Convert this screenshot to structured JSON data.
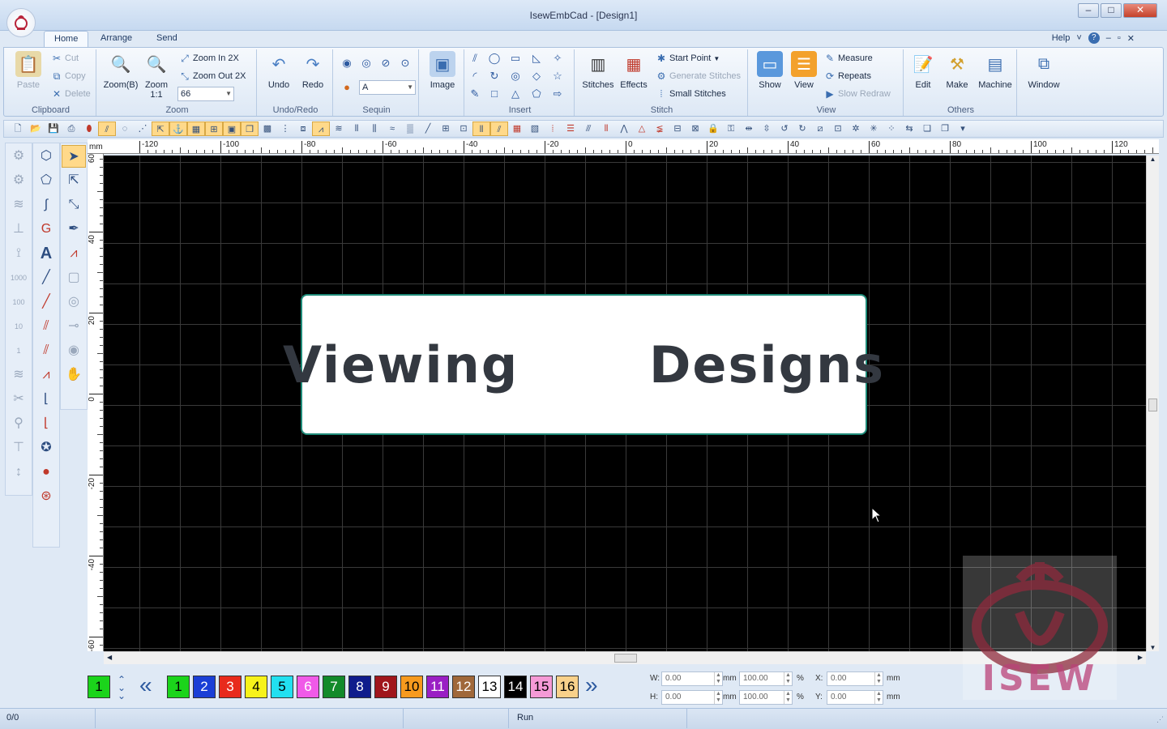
{
  "window": {
    "title": "IsewEmbCad - [Design1]",
    "min": "–",
    "max": "□",
    "close": "✕"
  },
  "tabs": [
    "Home",
    "Arrange",
    "Send"
  ],
  "help": {
    "label": "Help",
    "dropdown": "˅",
    "help_icon": "?",
    "min": "–",
    "restore": "▫",
    "close": "✕"
  },
  "ribbon": {
    "clipboard": {
      "label": "Clipboard",
      "paste": "Paste",
      "cut": "Cut",
      "copy": "Copy",
      "delete": "Delete"
    },
    "zoom": {
      "label": "Zoom",
      "zoom_b": "Zoom(B)",
      "zoom_11_line1": "Zoom",
      "zoom_11_line2": "1:1",
      "zoom_in": "Zoom In 2X",
      "zoom_out": "Zoom Out 2X",
      "zoom_value": "66"
    },
    "undo_redo": {
      "label": "Undo/Redo",
      "undo": "Undo",
      "redo": "Redo"
    },
    "sequin": {
      "label": "Sequin",
      "value": "A"
    },
    "image": {
      "label": "Image"
    },
    "insert": {
      "label": "Insert"
    },
    "stitch": {
      "label": "Stitch",
      "stitches": "Stitches",
      "effects": "Effects",
      "start_point": "Start Point",
      "generate": "Generate Stitches",
      "small": "Small Stitches"
    },
    "view": {
      "label": "View",
      "show": "Show",
      "view": "View",
      "measure": "Measure",
      "repeats": "Repeats",
      "slow_redraw": "Slow Redraw"
    },
    "others": {
      "label": "Others",
      "edit": "Edit",
      "make": "Make",
      "machine": "Machine"
    },
    "window": {
      "label": "Window"
    }
  },
  "ruler": {
    "unit": "mm",
    "top_ticks": [
      "-120",
      "-100",
      "-80",
      "-60",
      "-40",
      "-20",
      "0",
      "20",
      "40",
      "60",
      "80",
      "100",
      "120"
    ],
    "left_ticks": [
      "60",
      "40",
      "20",
      "0",
      "-20",
      "-40",
      "-60"
    ]
  },
  "overlay": {
    "text": "Viewing   Designs"
  },
  "colors": {
    "current": "1",
    "swatches": [
      {
        "n": "1",
        "bg": "#1bd41b",
        "fg": "#000000"
      },
      {
        "n": "2",
        "bg": "#1a3fd6",
        "fg": "#ffffff"
      },
      {
        "n": "3",
        "bg": "#e82a1c",
        "fg": "#ffffff"
      },
      {
        "n": "4",
        "bg": "#f7f21a",
        "fg": "#000000"
      },
      {
        "n": "5",
        "bg": "#22e0f0",
        "fg": "#000000"
      },
      {
        "n": "6",
        "bg": "#f05ae8",
        "fg": "#ffffff"
      },
      {
        "n": "7",
        "bg": "#128a2a",
        "fg": "#ffffff"
      },
      {
        "n": "8",
        "bg": "#0f1c8c",
        "fg": "#ffffff"
      },
      {
        "n": "9",
        "bg": "#a0161c",
        "fg": "#ffffff"
      },
      {
        "n": "10",
        "bg": "#f79a1e",
        "fg": "#000000"
      },
      {
        "n": "11",
        "bg": "#9a1fc4",
        "fg": "#ffffff"
      },
      {
        "n": "12",
        "bg": "#a0683a",
        "fg": "#ffffff"
      },
      {
        "n": "13",
        "bg": "#ffffff",
        "fg": "#000000"
      },
      {
        "n": "14",
        "bg": "#000000",
        "fg": "#ffffff"
      },
      {
        "n": "15",
        "bg": "#f59ad6",
        "fg": "#000000"
      },
      {
        "n": "16",
        "bg": "#f9d18a",
        "fg": "#000000"
      }
    ],
    "prev": "«",
    "next": "»"
  },
  "coords": {
    "w_label": "W:",
    "w_value": "0.00",
    "w_unit": "mm",
    "h_label": "H:",
    "h_value": "0.00",
    "h_unit": "mm",
    "wp_value": "100.00",
    "wp_unit": "%",
    "hp_value": "100.00",
    "hp_unit": "%",
    "x_label": "X:",
    "x_value": "0.00",
    "x_unit": "mm",
    "y_label": "Y:",
    "y_value": "0.00",
    "y_unit": "mm"
  },
  "status": {
    "count": "0/0",
    "mode": "Run"
  },
  "watermark": {
    "text": "ISEW"
  }
}
